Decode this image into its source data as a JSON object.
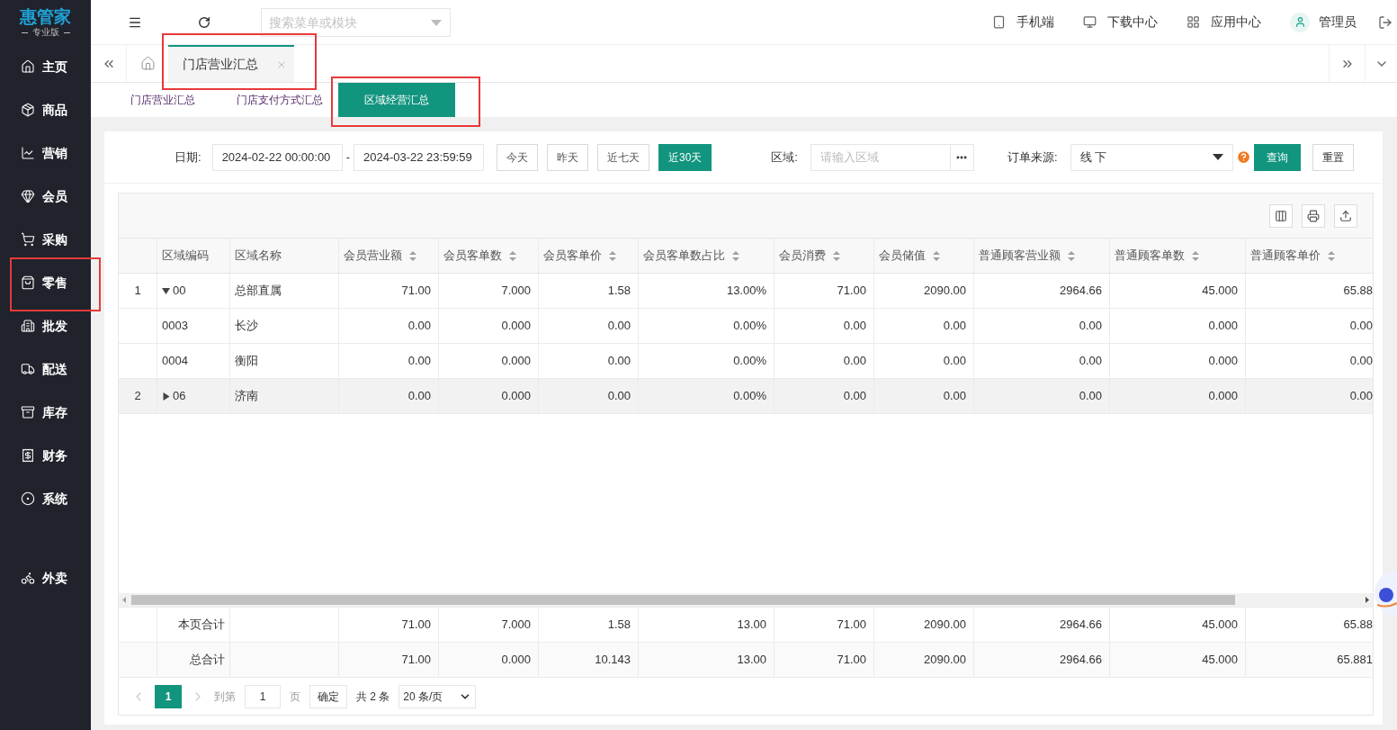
{
  "brand": {
    "name": "惠管家",
    "edition": "专业版"
  },
  "sidebar": {
    "items": [
      {
        "label": "主页"
      },
      {
        "label": "商品"
      },
      {
        "label": "营销"
      },
      {
        "label": "会员"
      },
      {
        "label": "采购"
      },
      {
        "label": "零售"
      },
      {
        "label": "批发"
      },
      {
        "label": "配送"
      },
      {
        "label": "库存"
      },
      {
        "label": "财务"
      },
      {
        "label": "系统"
      }
    ],
    "bottom_items": [
      {
        "label": "外卖"
      }
    ]
  },
  "top_bar": {
    "search_placeholder": "搜索菜单或模块",
    "links": [
      "手机端",
      "下载中心",
      "应用中心"
    ],
    "user": "管理员"
  },
  "page_tabs": [
    {
      "label": "门店营业汇总",
      "selected": true
    }
  ],
  "sub_tabs": [
    {
      "label": "门店营业汇总",
      "selected": false
    },
    {
      "label": "门店支付方式汇总",
      "selected": false
    },
    {
      "label": "区域经营汇总",
      "selected": true
    }
  ],
  "filters": {
    "date_label": "日期:",
    "date_from": "2024-02-22 00:00:00",
    "date_separator": "-",
    "date_to": "2024-03-22 23:59:59",
    "quick_ranges": [
      {
        "label": "今天",
        "selected": false
      },
      {
        "label": "昨天",
        "selected": false
      },
      {
        "label": "近七天",
        "selected": false
      },
      {
        "label": "近30天",
        "selected": true
      }
    ],
    "region_label": "区域:",
    "region_placeholder": "请输入区域",
    "source_label": "订单来源:",
    "source_value": "线 下",
    "query_button": "查询",
    "reset_button": "重置"
  },
  "table": {
    "columns": [
      {
        "label": "区域编码",
        "sortable": false
      },
      {
        "label": "区域名称",
        "sortable": false
      },
      {
        "label": "会员营业额",
        "sortable": true
      },
      {
        "label": "会员客单数",
        "sortable": true
      },
      {
        "label": "会员客单价",
        "sortable": true
      },
      {
        "label": "会员客单数占比",
        "sortable": true
      },
      {
        "label": "会员消费",
        "sortable": true
      },
      {
        "label": "会员储值",
        "sortable": true
      },
      {
        "label": "普通顾客营业额",
        "sortable": true
      },
      {
        "label": "普通顾客单数",
        "sortable": true
      },
      {
        "label": "普通顾客单价",
        "sortable": true
      }
    ],
    "rows": [
      {
        "index": "1",
        "code": "00",
        "name": "总部直属",
        "expanded": true,
        "highlighted": false,
        "values": [
          "71.00",
          "7.000",
          "1.58",
          "13.00%",
          "71.00",
          "2090.00",
          "2964.66",
          "45.000",
          "65.88"
        ],
        "children": [
          {
            "code": "0003",
            "name": "长沙",
            "highlighted": false,
            "values": [
              "0.00",
              "0.000",
              "0.00",
              "0.00%",
              "0.00",
              "0.00",
              "0.00",
              "0.000",
              "0.00"
            ]
          },
          {
            "code": "0004",
            "name": "衡阳",
            "highlighted": false,
            "values": [
              "0.00",
              "0.000",
              "0.00",
              "0.00%",
              "0.00",
              "0.00",
              "0.00",
              "0.000",
              "0.00"
            ]
          }
        ]
      },
      {
        "index": "2",
        "code": "06",
        "name": "济南",
        "expanded": false,
        "highlighted": true,
        "values": [
          "0.00",
          "0.000",
          "0.00",
          "0.00%",
          "0.00",
          "0.00",
          "0.00",
          "0.000",
          "0.00"
        ]
      }
    ],
    "totals": [
      {
        "label": "本页合计",
        "values": [
          "71.00",
          "7.000",
          "1.58",
          "13.00",
          "71.00",
          "2090.00",
          "2964.66",
          "45.000",
          "65.88"
        ]
      },
      {
        "label": "总合计",
        "values": [
          "71.00",
          "0.000",
          "10.143",
          "13.00",
          "71.00",
          "2090.00",
          "2964.66",
          "45.000",
          "65.881"
        ]
      }
    ]
  },
  "pagination": {
    "pages": [
      {
        "label": "1",
        "selected": true
      }
    ],
    "goto_label": "到第",
    "goto_value": "1",
    "page_unit": "页",
    "confirm": "确定",
    "total": "共 2 条",
    "page_size": "20 条/页"
  }
}
